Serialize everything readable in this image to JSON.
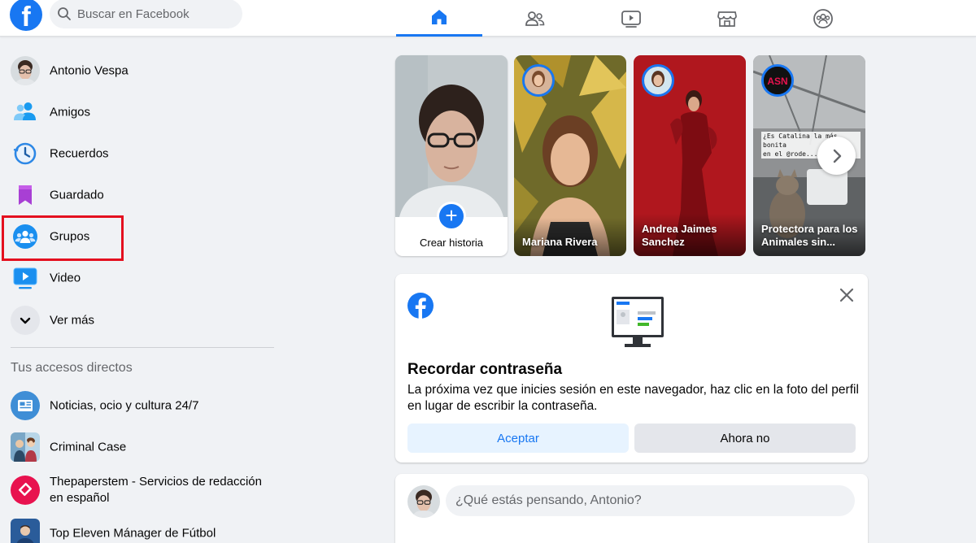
{
  "topbar": {
    "search_placeholder": "Buscar en Facebook",
    "logo_letter": "f",
    "nav_tabs": [
      {
        "icon": "home-icon",
        "active": true
      },
      {
        "icon": "friends-icon",
        "active": false
      },
      {
        "icon": "watch-icon",
        "active": false
      },
      {
        "icon": "marketplace-icon",
        "active": false
      },
      {
        "icon": "groups-icon",
        "active": false
      }
    ]
  },
  "sidebar": {
    "items": [
      {
        "label": "Antonio Vespa",
        "icon": "avatar"
      },
      {
        "label": "Amigos",
        "icon": "friends-icon"
      },
      {
        "label": "Recuerdos",
        "icon": "memories-clock-icon"
      },
      {
        "label": "Guardado",
        "icon": "bookmark-icon"
      },
      {
        "label": "Grupos",
        "icon": "groups-icon"
      },
      {
        "label": "Video",
        "icon": "video-icon"
      },
      {
        "label": "Ver más",
        "icon": "chevron-down-icon"
      }
    ],
    "shortcuts_title": "Tus accesos directos",
    "shortcuts": [
      {
        "label": "Noticias, ocio y cultura 24/7"
      },
      {
        "label": "Criminal Case"
      },
      {
        "label_line1": "Thepaperstem - Servicios de redacción",
        "label_line2": "en español"
      },
      {
        "label": "Top Eleven Mánager de Fútbol"
      }
    ]
  },
  "stories": {
    "create_label": "Crear historia",
    "items": [
      {
        "name": "Mariana Rivera"
      },
      {
        "name_line1": "Andrea Jaimes",
        "name_line2": "Sanchez"
      },
      {
        "name_line1": "Protectora para los",
        "name_line2": "Animales sin...",
        "overlay_line1": "¿Es Catalina la más bonita",
        "overlay_line2": "en el @rode..."
      }
    ]
  },
  "remember_password": {
    "title": "Recordar contraseña",
    "text": "La próxima vez que inicies sesión en este navegador, haz clic en la foto del perfil en lugar de escribir la contraseña.",
    "accept_label": "Aceptar",
    "later_label": "Ahora no"
  },
  "composer": {
    "placeholder": "¿Qué estás pensando, Antonio?"
  },
  "colors": {
    "brand": "#1877f2",
    "highlight": "#e4101f",
    "background": "#f0f2f5"
  }
}
